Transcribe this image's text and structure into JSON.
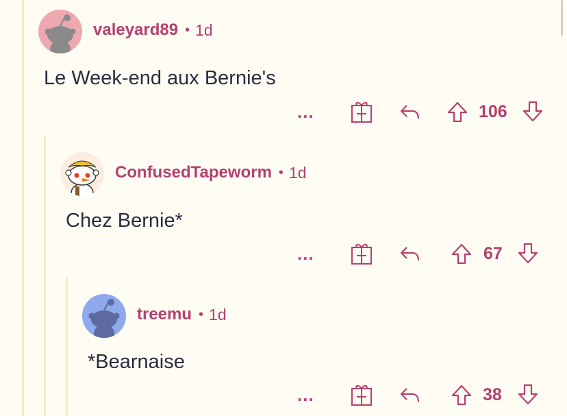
{
  "colors": {
    "accent": "#b4406e",
    "background": "#fffdf3",
    "thread_line": "#f3ecc8",
    "text": "#2b2b40"
  },
  "comments": [
    {
      "username": "valeyard89",
      "age": "1d",
      "avatar": "pink-snoo-avatar",
      "text": "Le Week-end aux Bernie's",
      "votes": "106",
      "more_label": "..."
    },
    {
      "username": "ConfusedTapeworm",
      "age": "1d",
      "avatar": "custom-snoo-avatar",
      "text": "Chez Bernie*",
      "votes": "67",
      "more_label": "..."
    },
    {
      "username": "treemu",
      "age": "1d",
      "avatar": "blue-snoo-avatar",
      "text": "*Bearnaise",
      "votes": "38",
      "more_label": "..."
    }
  ],
  "separator": "•",
  "icons": [
    "more-icon",
    "gift-icon",
    "reply-icon",
    "upvote-icon",
    "downvote-icon"
  ]
}
